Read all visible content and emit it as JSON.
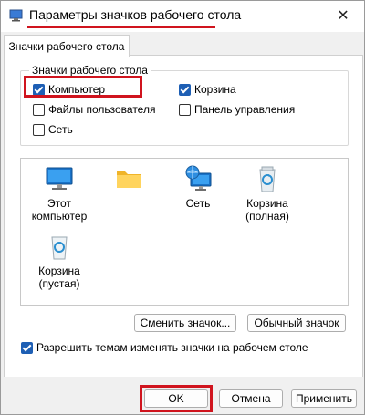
{
  "window": {
    "title": "Параметры значков рабочего стола",
    "close_symbol": "✕"
  },
  "tabs": [
    {
      "label": "Значки рабочего стола",
      "active": true
    }
  ],
  "group": {
    "legend": "Значки рабочего стола",
    "checkboxes": [
      {
        "label": "Компьютер",
        "checked": true,
        "highlighted": true
      },
      {
        "label": "Корзина",
        "checked": true
      },
      {
        "label": "Файлы пользователя",
        "checked": false
      },
      {
        "label": "Панель управления",
        "checked": false
      },
      {
        "label": "Сеть",
        "checked": false
      }
    ]
  },
  "icons": [
    {
      "label": "Этот компьютер",
      "icon": "monitor-icon"
    },
    {
      "label": "",
      "icon": "folder-icon"
    },
    {
      "label": "Сеть",
      "icon": "network-icon"
    },
    {
      "label": "Корзина (полная)",
      "icon": "recycle-bin-full-icon"
    },
    {
      "label": "Корзина (пустая)",
      "icon": "recycle-bin-empty-icon"
    }
  ],
  "buttons": {
    "change_icon": "Сменить значок...",
    "default_icon": "Обычный значок",
    "ok": "OK",
    "cancel": "Отмена",
    "apply": "Применить"
  },
  "allow_themes": {
    "label": "Разрешить темам изменять значки на рабочем столе",
    "checked": true
  },
  "colors": {
    "accent": "#1e5fb4",
    "highlight": "#d0141e"
  }
}
